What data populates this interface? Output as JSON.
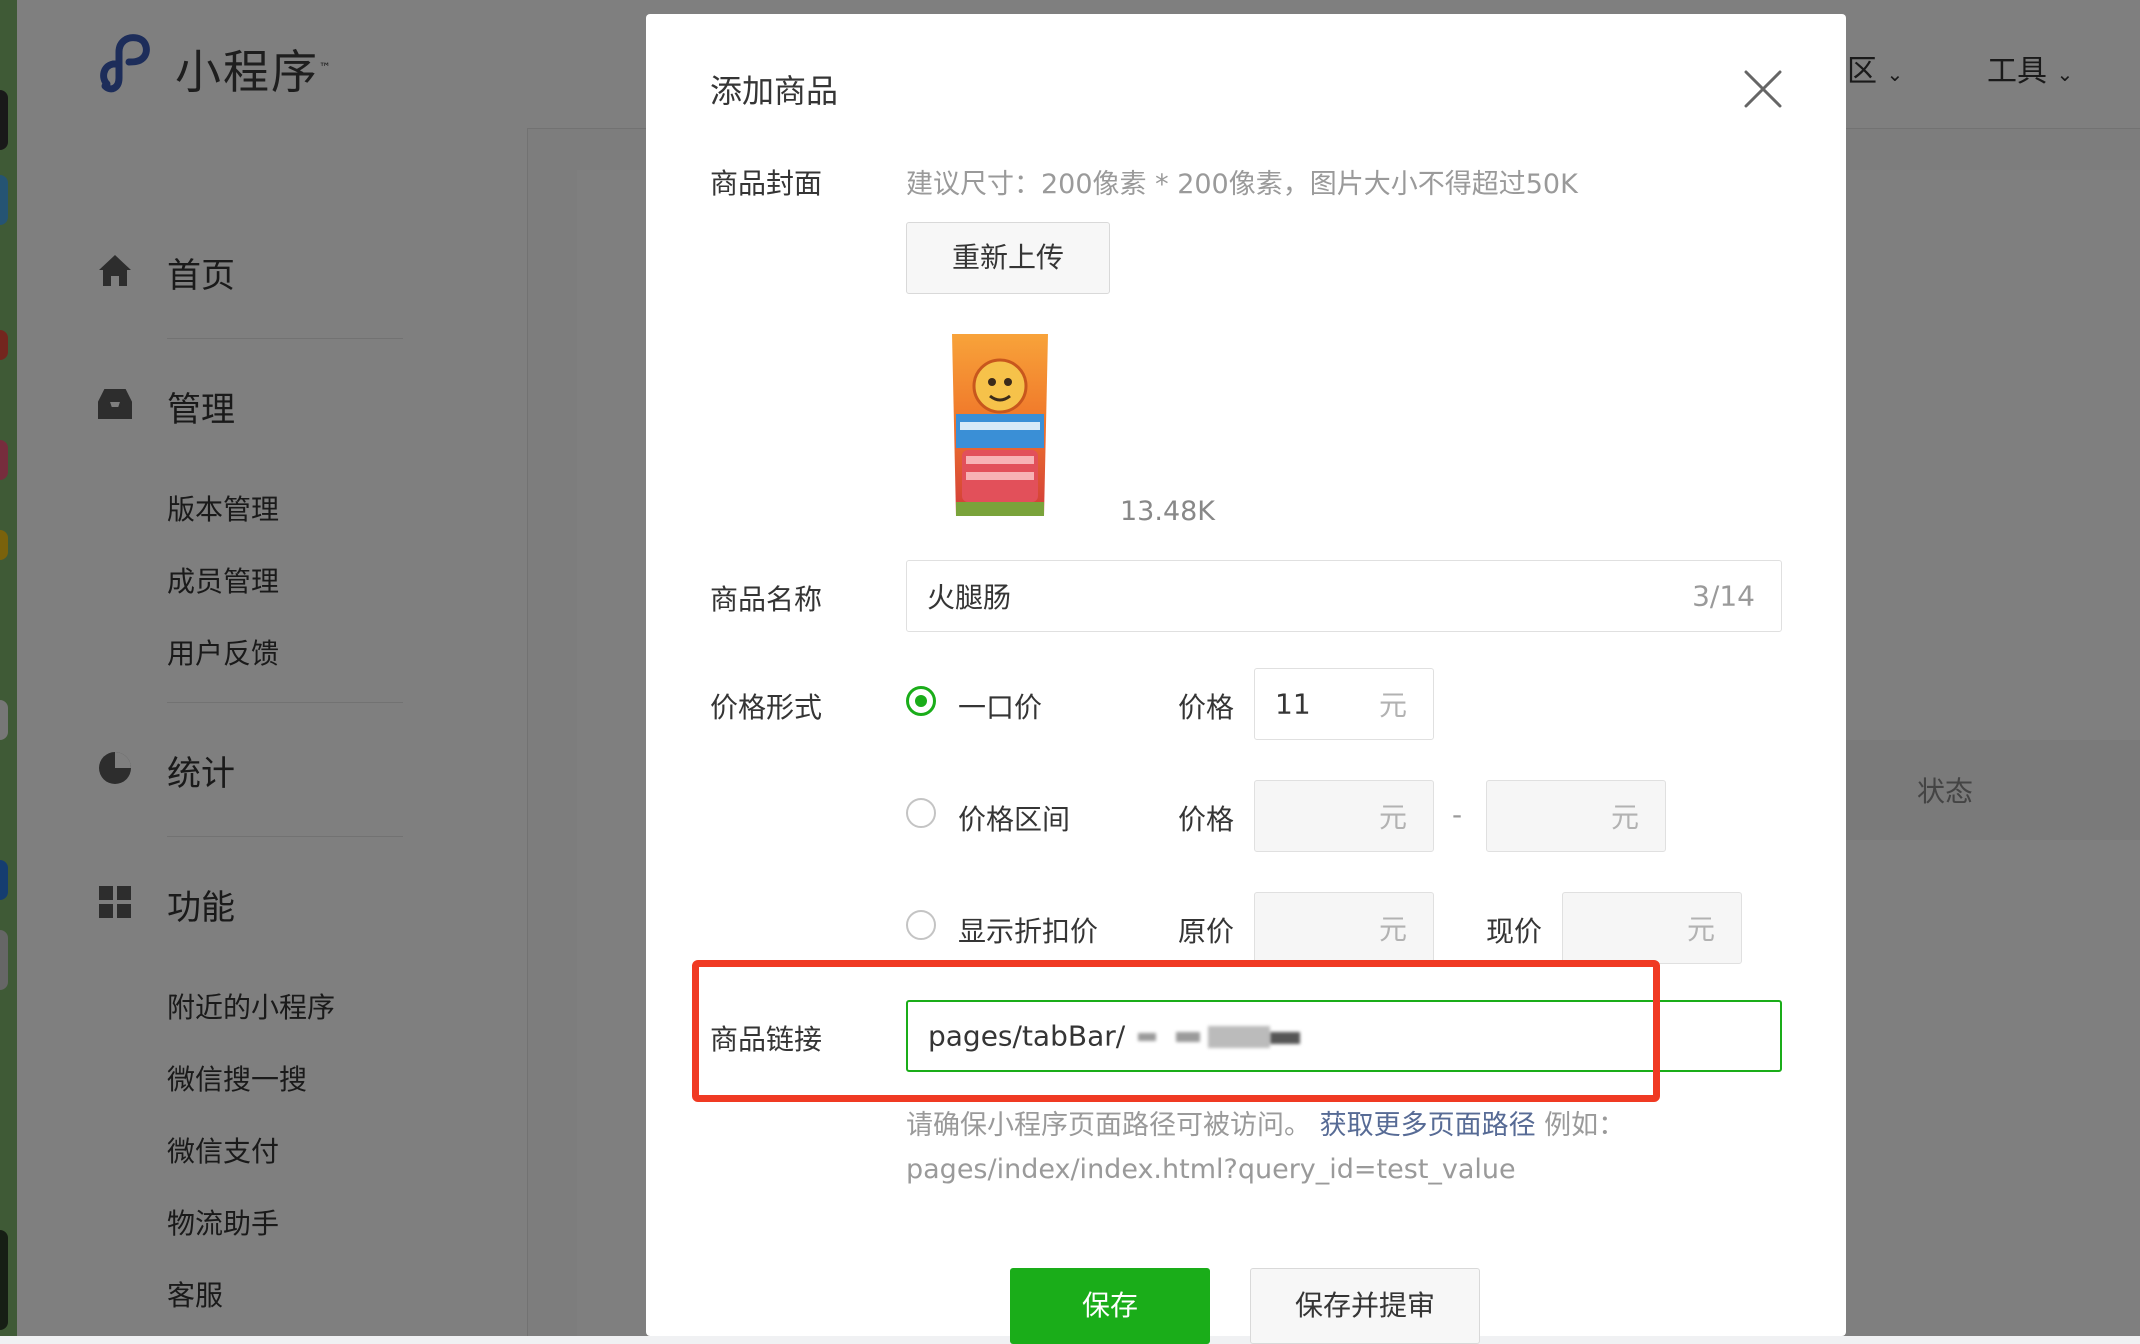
{
  "app": {
    "logo_text": "小程序",
    "trademark": "™",
    "nav_right": [
      "区",
      "工具"
    ]
  },
  "sidebar": {
    "home": "首页",
    "manage": "管理",
    "manage_items": [
      "版本管理",
      "成员管理",
      "用户反馈"
    ],
    "stats": "统计",
    "features": "功能",
    "feature_items": [
      "附近的小程序",
      "微信搜一搜",
      "微信支付",
      "物流助手",
      "客服"
    ]
  },
  "background_table": {
    "status_header": "状态"
  },
  "dialog": {
    "title": "添加商品",
    "cover": {
      "label": "商品封面",
      "hint": "建议尺寸：200像素 * 200像素，图片大小不得超过50K",
      "reupload_button": "重新上传",
      "file_size": "13.48K"
    },
    "name": {
      "label": "商品名称",
      "value": "火腿肠",
      "counter": "3/14"
    },
    "price": {
      "label": "价格形式",
      "options": [
        {
          "label": "一口价",
          "checked": true,
          "field_label": "价格",
          "value": "11",
          "unit": "元"
        },
        {
          "label": "价格区间",
          "checked": false,
          "field_label": "价格",
          "unit_min": "元",
          "separator": "-",
          "unit_max": "元"
        },
        {
          "label": "显示折扣价",
          "checked": false,
          "field_label_original": "原价",
          "unit_original": "元",
          "field_label_current": "现价",
          "unit_current": "元"
        }
      ]
    },
    "link": {
      "label": "商品链接",
      "value": "pages/tabBar/",
      "hint_prefix": "请确保小程序页面路径可被访问。",
      "hint_link": "获取更多页面路径",
      "hint_suffix": " 例如：pages/index/index.html?query_id=test_value"
    },
    "buttons": {
      "save": "保存",
      "save_submit": "保存并提审"
    }
  },
  "colors": {
    "primary_green": "#1aad19",
    "highlight_red": "#f03a23",
    "link_blue": "#576b95",
    "mask": "rgba(0,0,0,0.5)"
  }
}
